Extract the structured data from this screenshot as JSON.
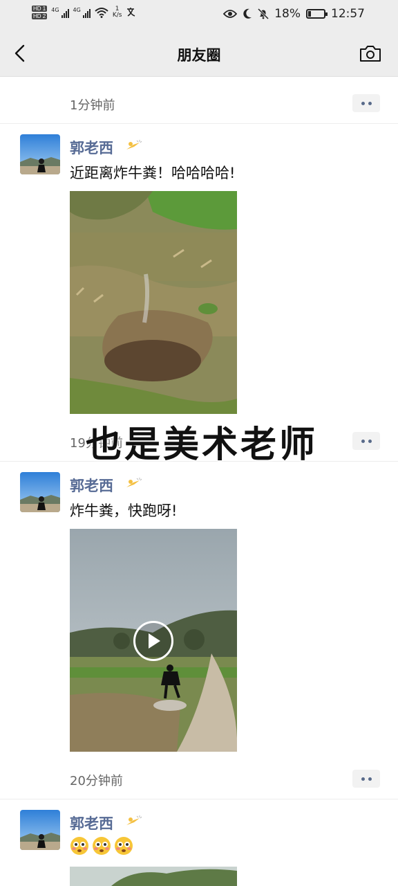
{
  "status_bar": {
    "hd1": "HD 1",
    "hd2": "HD 2",
    "net1": "4G",
    "net2": "4G",
    "speed_value": "1",
    "speed_unit": "K/s",
    "battery": "18%",
    "battery_level": 0.18,
    "time": "12:57"
  },
  "nav": {
    "title": "朋友圈",
    "back_icon": "chevron-left-icon",
    "camera_icon": "camera-icon"
  },
  "posts": [
    {
      "time": "1分钟前",
      "user": "郭老西",
      "text": "近距离炸牛粪！哈哈哈哈!",
      "media": "image",
      "more_icon": "more-dots-icon"
    },
    {
      "time": "19分钟前",
      "user": "郭老西",
      "text": "炸牛粪，快跑呀!",
      "media": "video",
      "more_icon": "more-dots-icon"
    },
    {
      "time": "20分钟前",
      "user": "郭老西",
      "emojis": [
        "😳",
        "😳",
        "😳"
      ],
      "media": "image",
      "more_icon": "more-dots-icon"
    }
  ],
  "caption_overlay": "也是美术老师",
  "colors": {
    "username": "#576b95",
    "bar_bg": "#ededed",
    "time_text": "#666666"
  }
}
